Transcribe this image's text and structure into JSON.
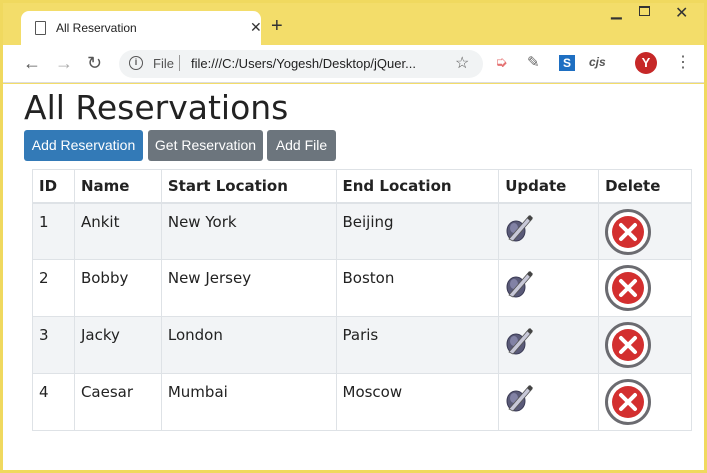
{
  "browser": {
    "tab_title": "All Reservation",
    "new_tab": "+",
    "close_tab": "✕",
    "scheme": "File",
    "url": "file:///C:/Users/Yogesh/Desktop/jQuer...",
    "ext_s": "S",
    "ext_cjs": "cjs",
    "ext_y": "Y"
  },
  "page": {
    "title": "All Reservations",
    "buttons": {
      "add": "Add Reservation",
      "get": "Get Reservation",
      "file": "Add File"
    }
  },
  "table": {
    "headers": [
      "ID",
      "Name",
      "Start Location",
      "End Location",
      "Update",
      "Delete"
    ],
    "rows": [
      {
        "id": "1",
        "name": "Ankit",
        "start": "New York",
        "end": "Beijing"
      },
      {
        "id": "2",
        "name": "Bobby",
        "start": "New Jersey",
        "end": "Boston"
      },
      {
        "id": "3",
        "name": "Jacky",
        "start": "London",
        "end": "Paris"
      },
      {
        "id": "4",
        "name": "Caesar",
        "start": "Mumbai",
        "end": "Moscow"
      }
    ],
    "update_icon": "edit-icon",
    "delete_icon": "delete-icon"
  },
  "colors": {
    "primary_button": "#337ab7",
    "secondary_button": "#6c757d",
    "delete_icon": "#d32f2f",
    "window_frame": "#f3dd6a"
  }
}
